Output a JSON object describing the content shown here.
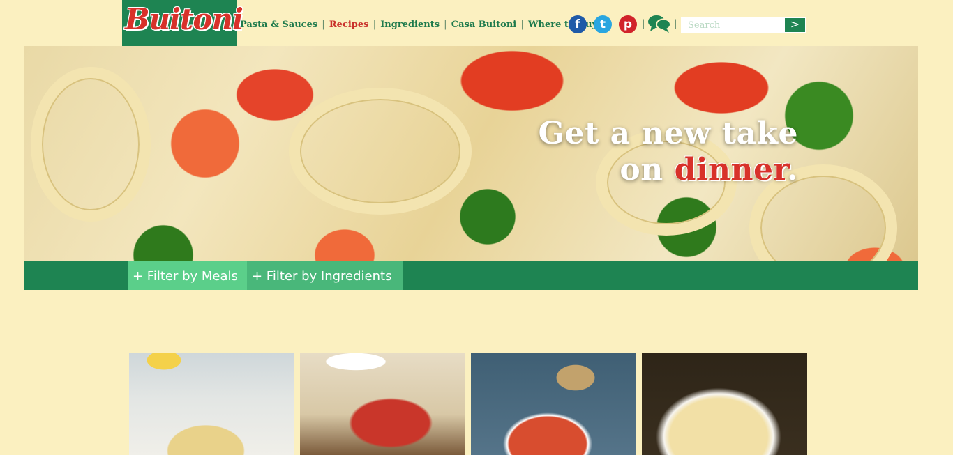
{
  "brand": {
    "logo_text": "Buitoni"
  },
  "nav": {
    "items": [
      {
        "label": "Pasta & Sauces",
        "active": false
      },
      {
        "label": "Recipes",
        "active": true
      },
      {
        "label": "Ingredients",
        "active": false
      },
      {
        "label": "Casa Buitoni",
        "active": false
      },
      {
        "label": "Where to Buy",
        "active": false
      }
    ]
  },
  "social": {
    "icons": [
      "facebook-icon",
      "twitter-icon",
      "pinterest-icon",
      "chat-bubbles-icon"
    ],
    "glyphs": {
      "facebook": "f",
      "twitter": "t",
      "pinterest": "p"
    }
  },
  "search": {
    "placeholder": "Search",
    "submit_glyph": ">"
  },
  "hero": {
    "line1": "Get a new take",
    "line2_prefix": "on ",
    "line2_accent": "dinner",
    "line2_suffix": "."
  },
  "filters": {
    "meals": "+ Filter by Meals",
    "ingredients": "+ Filter by Ingredients"
  },
  "colors": {
    "background": "#fbf0c0",
    "brand_green": "#1e8452",
    "brand_red": "#d8312a",
    "filter_active": "#5bcf8a"
  }
}
